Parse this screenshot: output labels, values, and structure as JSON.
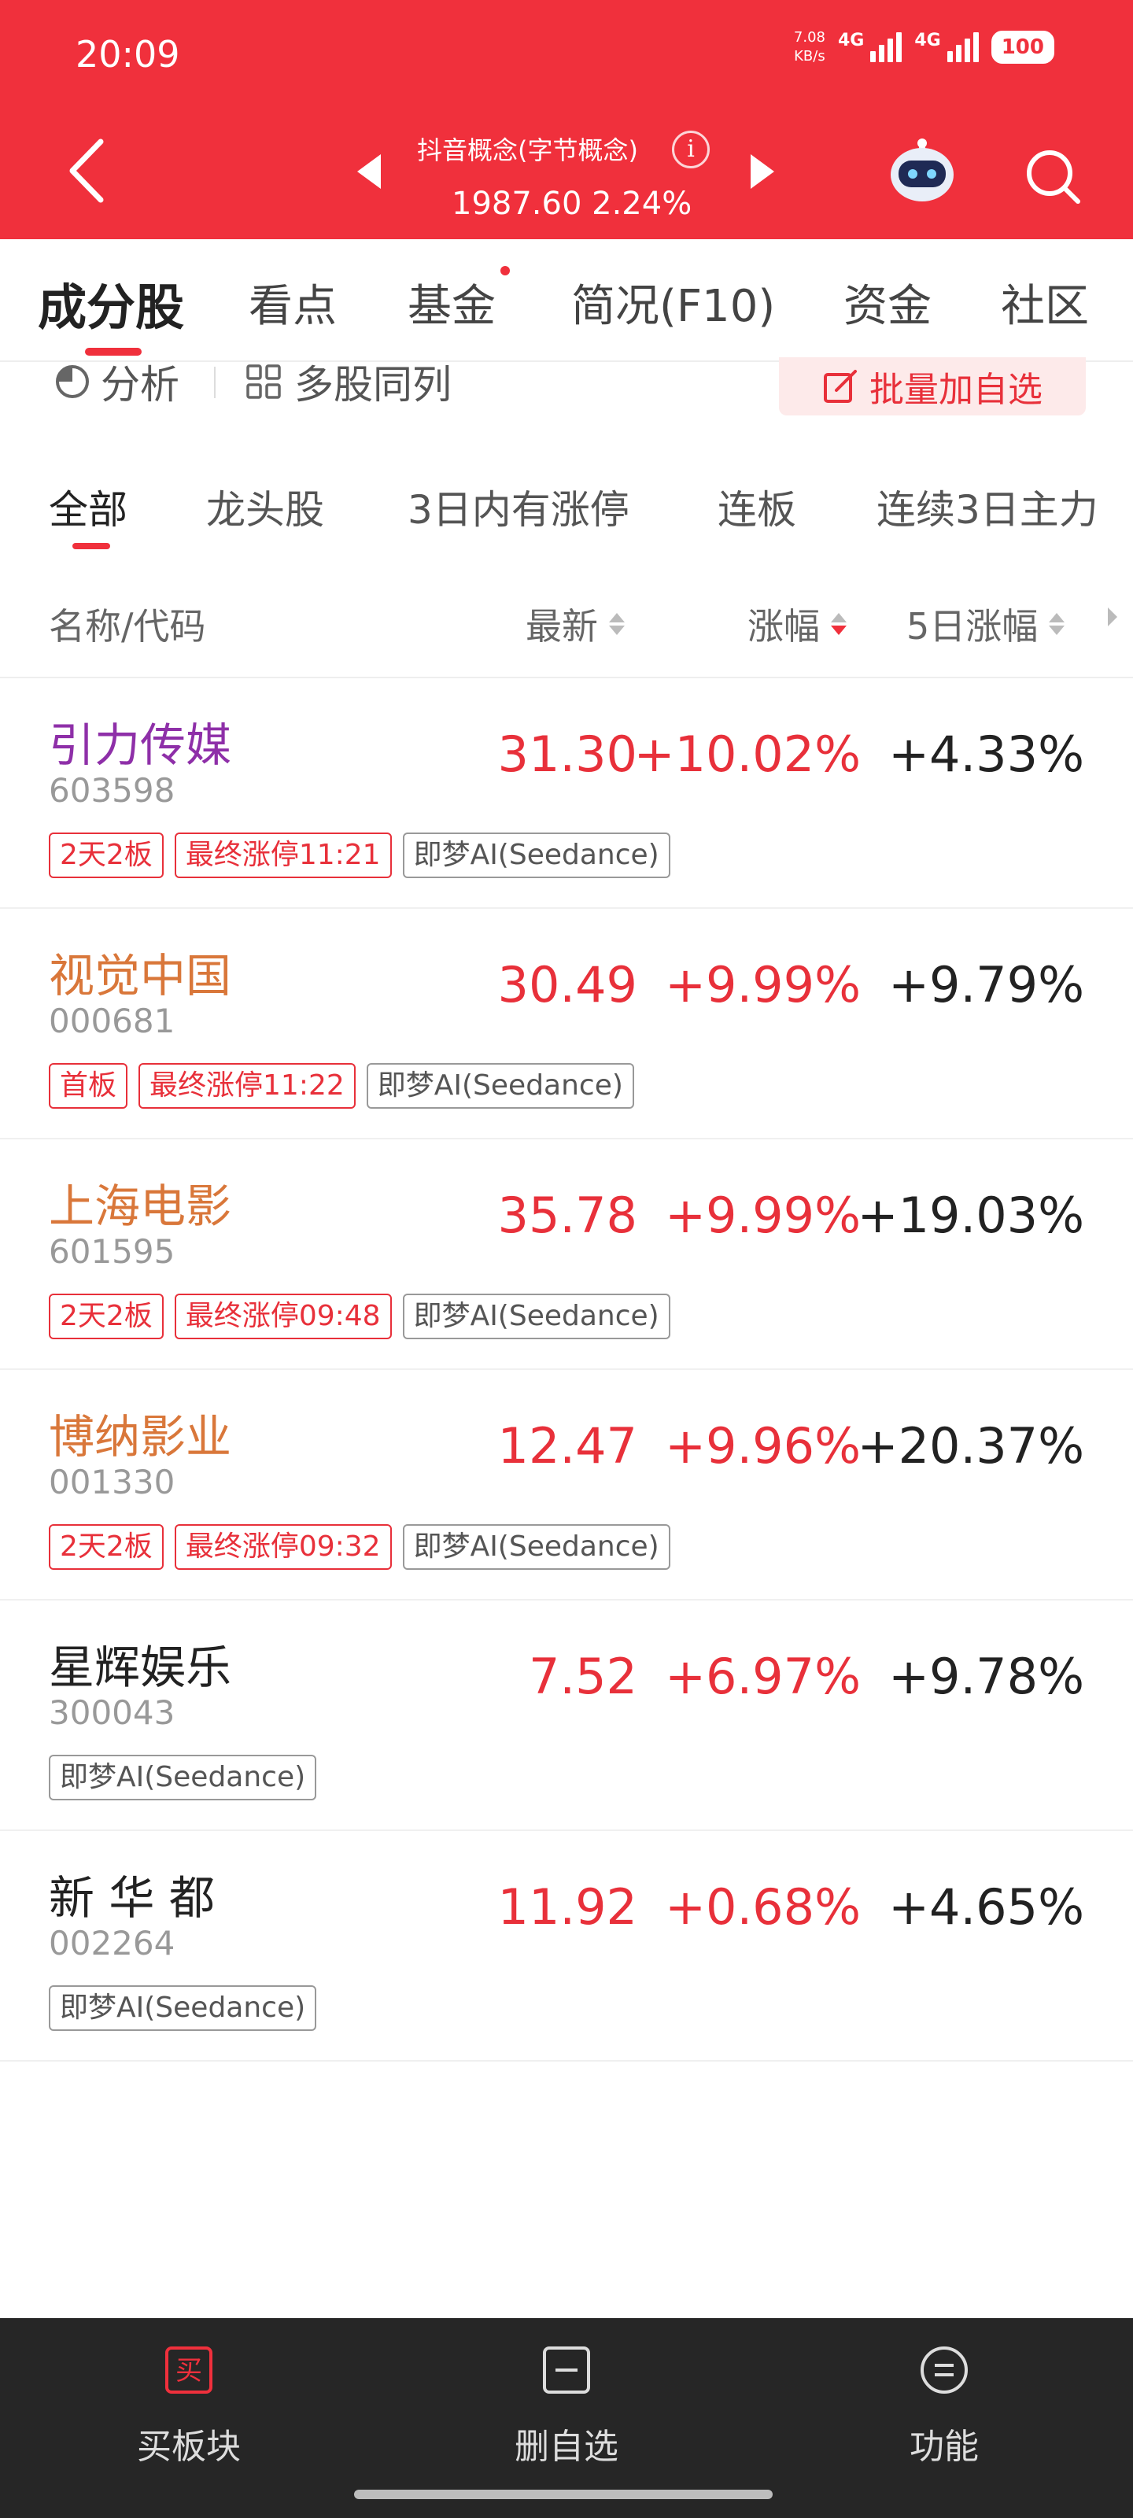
{
  "status_bar": {
    "time": "20:09",
    "net_speed_value": "7.08",
    "net_speed_unit": "KB/s",
    "signal1": "4G",
    "signal2": "4G",
    "battery": "100"
  },
  "header": {
    "title": "抖音概念(字节概念)",
    "index_value": "1987.60 2.24%",
    "info_icon": "i",
    "brand_color": "#f0303c"
  },
  "main_tabs": [
    {
      "label": "成分股",
      "active": true
    },
    {
      "label": "看点"
    },
    {
      "label": "基金",
      "has_dot": true
    },
    {
      "label": "简况(F10)"
    },
    {
      "label": "资金"
    },
    {
      "label": "社区"
    }
  ],
  "toolbar": {
    "analysis": "分析",
    "multi": "多股同列",
    "batch_add": "批量加自选"
  },
  "filter_tabs": [
    "全部",
    "龙头股",
    "3日内有涨停",
    "连板",
    "连续3日主力"
  ],
  "columns": {
    "name": "名称/代码",
    "price": "最新",
    "change": "涨幅",
    "five_day": "5日涨幅"
  },
  "stocks": [
    {
      "name": "引力传媒",
      "code": "603598",
      "price": "31.30",
      "change": "+10.02%",
      "five_day": "+4.33%",
      "name_color": "#8e2fa8",
      "tags": [
        {
          "text": "2天2板",
          "style": "red"
        },
        {
          "text": "最终涨停11:21",
          "style": "red"
        },
        {
          "text": "即梦AI(Seedance)",
          "style": "gray"
        }
      ]
    },
    {
      "name": "视觉中国",
      "code": "000681",
      "price": "30.49",
      "change": "+9.99%",
      "five_day": "+9.79%",
      "name_color": "#d9773a",
      "tags": [
        {
          "text": "首板",
          "style": "red"
        },
        {
          "text": "最终涨停11:22",
          "style": "red"
        },
        {
          "text": "即梦AI(Seedance)",
          "style": "gray"
        }
      ]
    },
    {
      "name": "上海电影",
      "code": "601595",
      "price": "35.78",
      "change": "+9.99%",
      "five_day": "+19.03%",
      "name_color": "#d9773a",
      "tags": [
        {
          "text": "2天2板",
          "style": "red"
        },
        {
          "text": "最终涨停09:48",
          "style": "red"
        },
        {
          "text": "即梦AI(Seedance)",
          "style": "gray"
        }
      ]
    },
    {
      "name": "博纳影业",
      "code": "001330",
      "price": "12.47",
      "change": "+9.96%",
      "five_day": "+20.37%",
      "name_color": "#d9773a",
      "tags": [
        {
          "text": "2天2板",
          "style": "red"
        },
        {
          "text": "最终涨停09:32",
          "style": "red"
        },
        {
          "text": "即梦AI(Seedance)",
          "style": "gray"
        }
      ]
    },
    {
      "name": "星辉娱乐",
      "code": "300043",
      "price": "7.52",
      "change": "+6.97%",
      "five_day": "+9.78%",
      "name_color": "#222222",
      "tags": [
        {
          "text": "即梦AI(Seedance)",
          "style": "gray"
        }
      ]
    },
    {
      "name": "新 华 都",
      "code": "002264",
      "price": "11.92",
      "change": "+0.68%",
      "five_day": "+4.65%",
      "name_color": "#222222",
      "tags": [
        {
          "text": "即梦AI(Seedance)",
          "style": "gray"
        }
      ]
    }
  ],
  "bottom_bar": {
    "buy": "买板块",
    "buy_icon_char": "买",
    "remove": "删自选",
    "functions": "功能"
  }
}
